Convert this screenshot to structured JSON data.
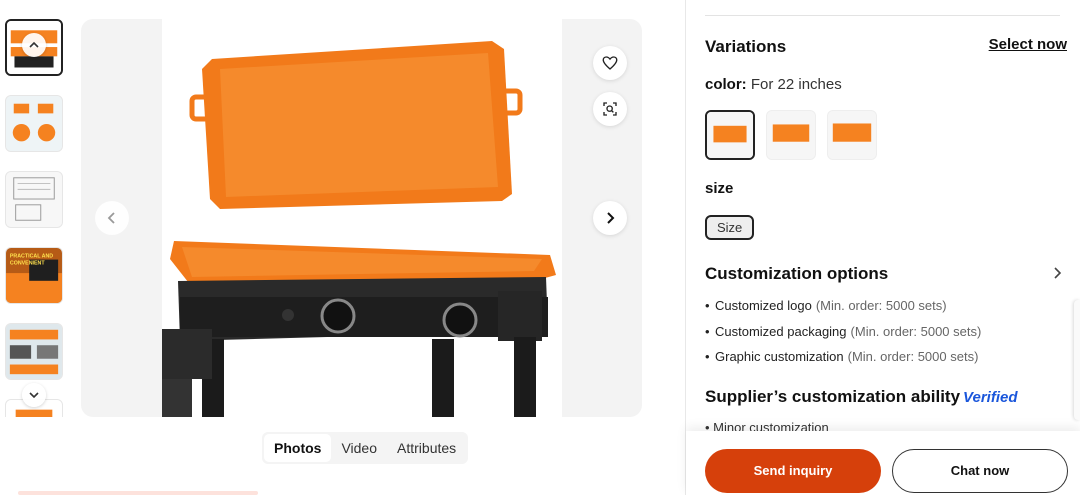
{
  "gallery": {
    "media_tabs": [
      {
        "label": "Photos",
        "active": true
      },
      {
        "label": "Video",
        "active": false
      },
      {
        "label": "Attributes",
        "active": false
      }
    ],
    "thumb_icons": [
      "chevron-up-icon",
      "chevron-down-icon"
    ],
    "action_icons": [
      "heart-icon",
      "image-search-icon"
    ],
    "nav_icons": [
      "chevron-left-icon",
      "chevron-right-icon"
    ],
    "thumb_texts": {
      "practical": "PRACTICAL AND",
      "convenient": "CONVENIENT"
    }
  },
  "variations": {
    "title": "Variations",
    "select_now": "Select now",
    "color_label": "color:",
    "color_value": "For 22 inches",
    "size_label": "size",
    "size_value": "Size"
  },
  "customization": {
    "title": "Customization options",
    "items": [
      {
        "label": "Customized logo",
        "moq": "(Min. order: 5000 sets)"
      },
      {
        "label": "Customized packaging",
        "moq": "(Min. order: 5000 sets)"
      },
      {
        "label": "Graphic customization",
        "moq": "(Min. order: 5000 sets)"
      }
    ]
  },
  "supplier": {
    "title": "Supplier’s customization ability",
    "verified_v": "V",
    "verified_rest": "erified",
    "first_item": "Minor customization"
  },
  "actions": {
    "send_inquiry": "Send inquiry",
    "chat_now": "Chat now"
  },
  "colors": {
    "accent": "#d6400b",
    "product_orange": "#f58220",
    "verified_blue": "#1a56db"
  }
}
